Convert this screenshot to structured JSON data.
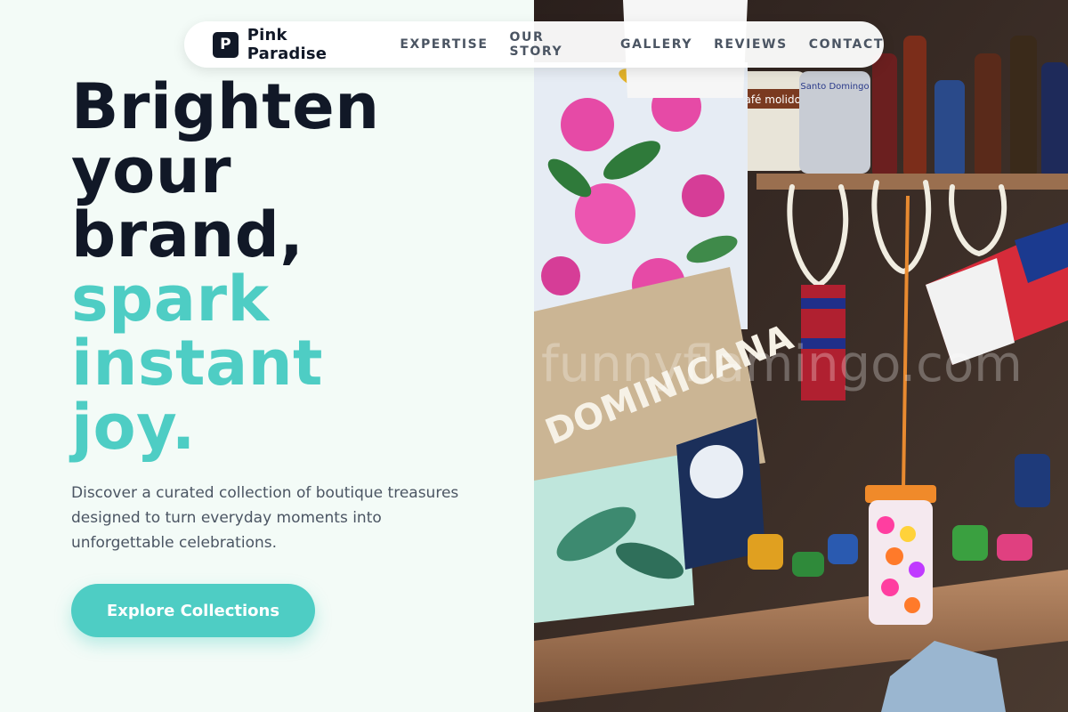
{
  "brand": {
    "logo_letter": "P",
    "name": "Pink Paradise"
  },
  "nav": {
    "links": [
      "EXPERTISE",
      "OUR STORY",
      "GALLERY",
      "REVIEWS",
      "CONTACT"
    ]
  },
  "hero": {
    "headline_dark": [
      "Brighten",
      "your",
      "brand,"
    ],
    "headline_accent": [
      "spark",
      "instant",
      "joy."
    ],
    "subtitle": "Discover a curated collection of boutique treasures designed to turn everyday moments into unforgettable celebrations.",
    "cta_label": "Explore Collections"
  },
  "photo": {
    "watermark": "funnyflamingo.com",
    "bag_print": "DOMINICANA",
    "sign_text": "Santo Domingo",
    "can_text": "Café molido"
  },
  "colors": {
    "background": "#f3fbf7",
    "text_dark": "#111827",
    "accent": "#4ecdc4",
    "text_muted": "#4b5563"
  },
  "icons": {
    "logo": "letter-p-badge"
  }
}
